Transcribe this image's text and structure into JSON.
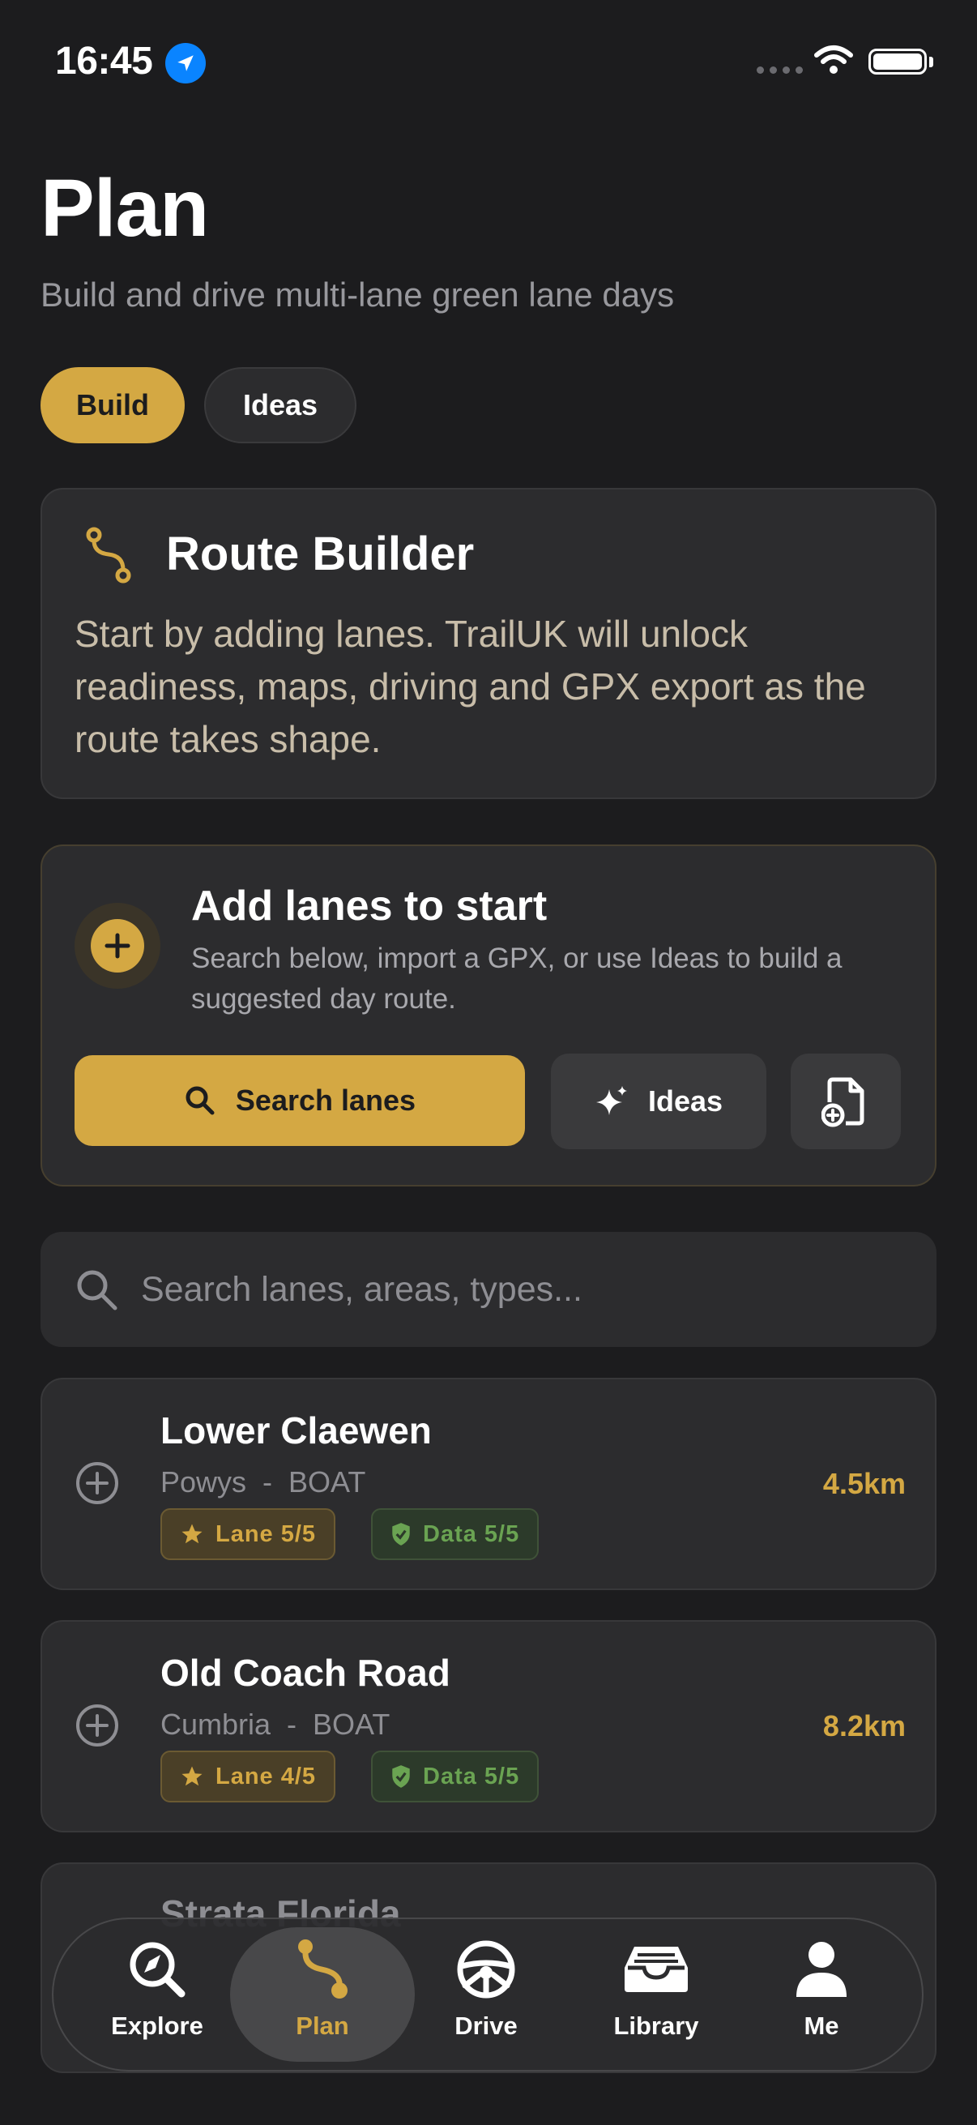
{
  "status_bar": {
    "time": "16:45"
  },
  "header": {
    "title": "Plan",
    "subtitle": "Build and drive multi-lane green lane days"
  },
  "segments": [
    {
      "label": "Build",
      "selected": true
    },
    {
      "label": "Ideas",
      "selected": false
    }
  ],
  "route_builder": {
    "title": "Route Builder",
    "body": "Start by adding lanes. TrailUK will unlock readiness, maps, driving and GPX export as the route takes shape."
  },
  "add_lanes": {
    "title": "Add lanes to start",
    "body": "Search below, import a GPX, or use Ideas to build a suggested day route.",
    "search_button": "Search lanes",
    "ideas_button": "Ideas"
  },
  "search": {
    "placeholder": "Search lanes, areas, types..."
  },
  "lanes": [
    {
      "name": "Lower Claewen",
      "region": "Powys",
      "type": "BOAT",
      "distance": "4.5km",
      "lane_rating": "Lane 5/5",
      "data_rating": "Data 5/5"
    },
    {
      "name": "Old Coach Road",
      "region": "Cumbria",
      "type": "BOAT",
      "distance": "8.2km",
      "lane_rating": "Lane 4/5",
      "data_rating": "Data 5/5"
    },
    {
      "name": "Strata Florida"
    }
  ],
  "tabbar": {
    "items": [
      {
        "label": "Explore",
        "icon": "explore-icon"
      },
      {
        "label": "Plan",
        "icon": "route-icon",
        "active": true
      },
      {
        "label": "Drive",
        "icon": "steering-wheel-icon"
      },
      {
        "label": "Library",
        "icon": "tray-icon"
      },
      {
        "label": "Me",
        "icon": "person-icon"
      }
    ]
  },
  "colors": {
    "accent": "#d4a843",
    "background": "#1c1c1e",
    "card": "#2c2c2e",
    "data_green": "#6aa352"
  }
}
